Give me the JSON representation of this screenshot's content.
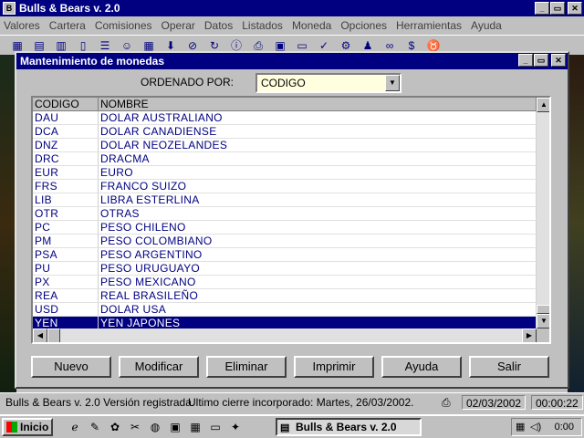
{
  "app": {
    "title": "Bulls & Bears v. 2.0",
    "win_buttons": [
      "_",
      "▭",
      "✕"
    ]
  },
  "menu": [
    "Valores",
    "Cartera",
    "Comisiones",
    "Operar",
    "Datos",
    "Listados",
    "Moneda",
    "Opciones",
    "Herramientas",
    "Ayuda"
  ],
  "toolbar_icons": [
    "grid-icon",
    "chart-icon",
    "table-icon",
    "document-icon",
    "list-icon",
    "users-icon",
    "calculator-icon",
    "download-icon",
    "stop-icon",
    "refresh-icon",
    "info-icon",
    "print-icon",
    "clipboard-icon",
    "monitor-icon",
    "check-icon",
    "settings-icon",
    "people-icon",
    "binoculars-icon",
    "dollar-icon",
    "bull-icon"
  ],
  "dialog": {
    "title": "Mantenimiento de monedas",
    "order_label": "ORDENADO POR:",
    "order_value": "CODIGO",
    "columns": [
      "CODIGO",
      "NOMBRE"
    ],
    "rows": [
      [
        "DAU",
        "DOLAR AUSTRALIANO"
      ],
      [
        "DCA",
        "DOLAR CANADIENSE"
      ],
      [
        "DNZ",
        "DOLAR NEOZELANDES"
      ],
      [
        "DRC",
        "DRACMA"
      ],
      [
        "EUR",
        "EURO"
      ],
      [
        "FRS",
        "FRANCO SUIZO"
      ],
      [
        "LIB",
        "LIBRA ESTERLINA"
      ],
      [
        "OTR",
        "OTRAS"
      ],
      [
        "PC",
        "PESO CHILENO"
      ],
      [
        "PM",
        "PESO COLOMBIANO"
      ],
      [
        "PSA",
        "PESO ARGENTINO"
      ],
      [
        "PU",
        "PESO URUGUAYO"
      ],
      [
        "PX",
        "PESO MEXICANO"
      ],
      [
        "REA",
        "REAL BRASILEÑO"
      ],
      [
        "USD",
        "DOLAR USA"
      ],
      [
        "YEN",
        "YEN JAPONES"
      ]
    ],
    "selected_row": 15,
    "buttons": {
      "nuevo": "Nuevo",
      "modificar": "Modificar",
      "eliminar": "Eliminar",
      "imprimir": "Imprimir",
      "ayuda": "Ayuda",
      "salir": "Salir"
    }
  },
  "status": {
    "left": "Bulls & Bears v. 2.0  Versión registrada.",
    "middle": "Ultimo cierre incorporado: Martes, 26/03/2002.",
    "date": "02/03/2002",
    "time": "00:00:22"
  },
  "taskbar": {
    "start": "Inicio",
    "task": "Bulls & Bears v. 2.0",
    "clock": "0:00"
  }
}
